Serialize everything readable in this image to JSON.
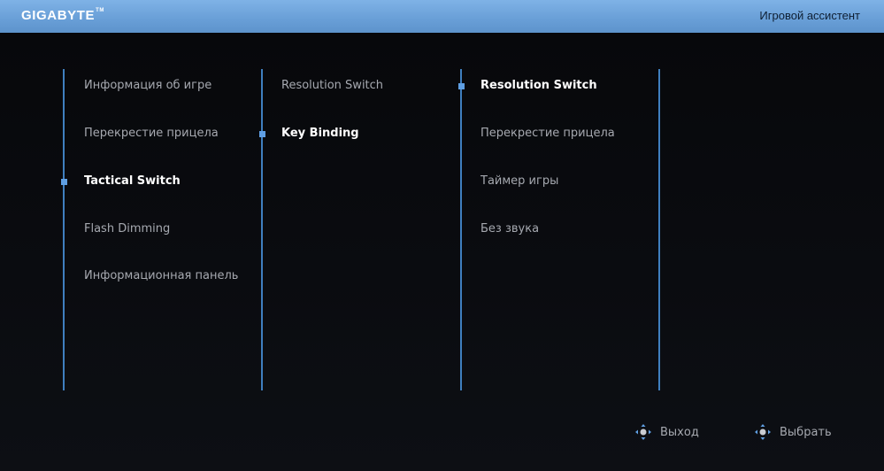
{
  "header": {
    "brand": "GIGABYTE",
    "brand_tm": "TM",
    "title": "Игровой ассистент",
    "accent_color": "#6aa0d8"
  },
  "columns": [
    {
      "items": [
        {
          "label": "Информация об игре",
          "active": false
        },
        {
          "label": "Перекрестие прицела",
          "active": false
        },
        {
          "label": "Tactical Switch",
          "active": true
        },
        {
          "label": "Flash Dimming",
          "active": false
        },
        {
          "label": "Информационная панель",
          "active": false
        }
      ]
    },
    {
      "items": [
        {
          "label": "Resolution Switch",
          "active": false
        },
        {
          "label": "Key Binding",
          "active": true
        }
      ]
    },
    {
      "items": [
        {
          "label": "Resolution Switch",
          "active": true
        },
        {
          "label": "Перекрестие прицела",
          "active": false
        },
        {
          "label": "Таймер игры",
          "active": false
        },
        {
          "label": "Без звука",
          "active": false
        }
      ]
    }
  ],
  "footer": {
    "exit_label": "Выход",
    "select_label": "Выбрать",
    "icon": "joystick-nav-icon"
  },
  "colors": {
    "marker": "#5f9fe3",
    "divider": "#3f7fbf",
    "active_text": "#ffffff",
    "inactive_text": "#a6a9b0"
  }
}
